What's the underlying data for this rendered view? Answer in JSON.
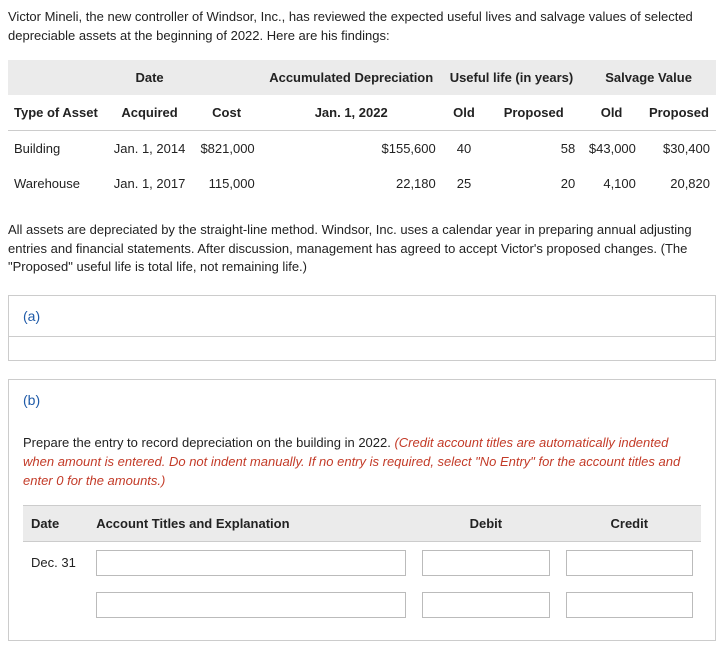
{
  "intro": "Victor Mineli, the new controller of Windsor, Inc., has reviewed the expected useful lives and salvage values of selected depreciable assets at the beginning of 2022. Here are his findings:",
  "table": {
    "group_headers": {
      "blank1": "",
      "date": "Date",
      "blank2": "",
      "accum": "Accumulated Depreciation",
      "useful": "Useful life (in years)",
      "salvage": "Salvage Value"
    },
    "col_headers": {
      "type": "Type of Asset",
      "acquired": "Acquired",
      "cost": "Cost",
      "jan": "Jan. 1, 2022",
      "old_life": "Old",
      "prop_life": "Proposed",
      "old_salv": "Old",
      "prop_salv": "Proposed"
    },
    "rows": [
      {
        "type": "Building",
        "acquired": "Jan. 1, 2014",
        "cost": "$821,000",
        "accum": "$155,600",
        "old_life": "40",
        "prop_life": "58",
        "old_salv": "$43,000",
        "prop_salv": "$30,400"
      },
      {
        "type": "Warehouse",
        "acquired": "Jan. 1, 2017",
        "cost": "115,000",
        "accum": "22,180",
        "old_life": "25",
        "prop_life": "20",
        "old_salv": "4,100",
        "prop_salv": "20,820"
      }
    ]
  },
  "note": "All assets are depreciated by the straight-line method. Windsor, Inc. uses a calendar year in preparing annual adjusting entries and financial statements. After discussion, management has agreed to accept Victor's proposed changes. (The \"Proposed\" useful life is total life, not remaining life.)",
  "parts": {
    "a": "(a)",
    "b": "(b)"
  },
  "prepare_plain": "Prepare the entry to record depreciation on the building in 2022. ",
  "prepare_red": "(Credit account titles are automatically indented when amount is entered. Do not indent manually. If no entry is required, select \"No Entry\" for the account titles and enter 0 for the amounts.)",
  "je": {
    "headers": {
      "date": "Date",
      "acct": "Account Titles and Explanation",
      "debit": "Debit",
      "credit": "Credit"
    },
    "date": "Dec. 31"
  }
}
